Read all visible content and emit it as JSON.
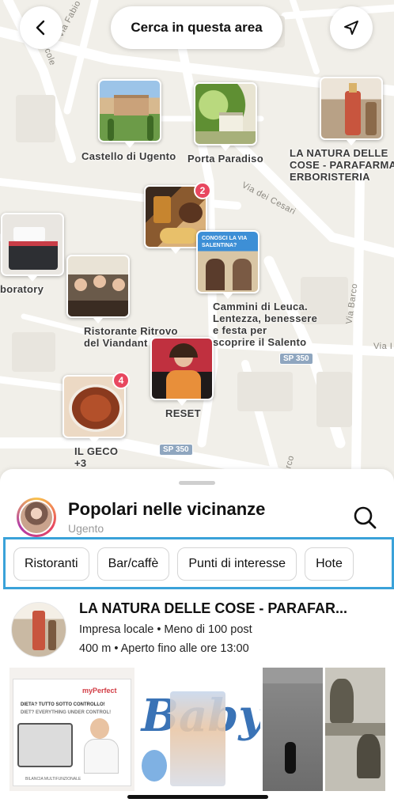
{
  "map": {
    "search_area_label": "Cerca in questa area",
    "streets": [
      "Via Fabio",
      "cole",
      "Via dei Cesari",
      "Via Barco",
      "Via I",
      "rco"
    ],
    "road_badges": [
      "SP 350",
      "SP 350"
    ],
    "pins": [
      {
        "label": "Castello di Ugento",
        "badge": null
      },
      {
        "label": "Porta Paradiso",
        "badge": null
      },
      {
        "label": "LA NATURA DELLE\nCOSE - PARAFARMA\nERBORISTERIA",
        "badge": null
      },
      {
        "label": "",
        "badge": "2"
      },
      {
        "label": "boratory",
        "badge": null
      },
      {
        "label": "Cammini di Leuca.\nLentezza, benessere\ne festa per\nscoprire il Salento",
        "badge": null,
        "image_text": "CONOSCI LA VIA SALENTINA?"
      },
      {
        "label": "Ristorante Ritrovo\ndel Viandant",
        "badge": null
      },
      {
        "label": "RESET",
        "badge": null
      },
      {
        "label": "IL GECO\n+3",
        "badge": "4"
      }
    ]
  },
  "sheet": {
    "title": "Popolari nelle vicinanze",
    "subtitle": "Ugento",
    "chips": [
      "Ristoranti",
      "Bar/caffè",
      "Punti di interesse",
      "Hote"
    ],
    "result": {
      "title": "LA NATURA DELLE COSE - PARAFAR...",
      "meta": "Impresa locale • Meno di 100 post",
      "distance": "400 m • Aperto fino alle ore 13:00"
    },
    "gallery": {
      "photo1_brand": "myPerfect",
      "photo1_text1": "DIETA? TUTTO SOTTO CONTROLLO!",
      "photo1_text2": "DIET? EVERYTHING UNDER CONTROL!",
      "photo1_caption": "BILANCIA MULTIFUNZIONALE",
      "photo2_text": "Baby!"
    }
  }
}
